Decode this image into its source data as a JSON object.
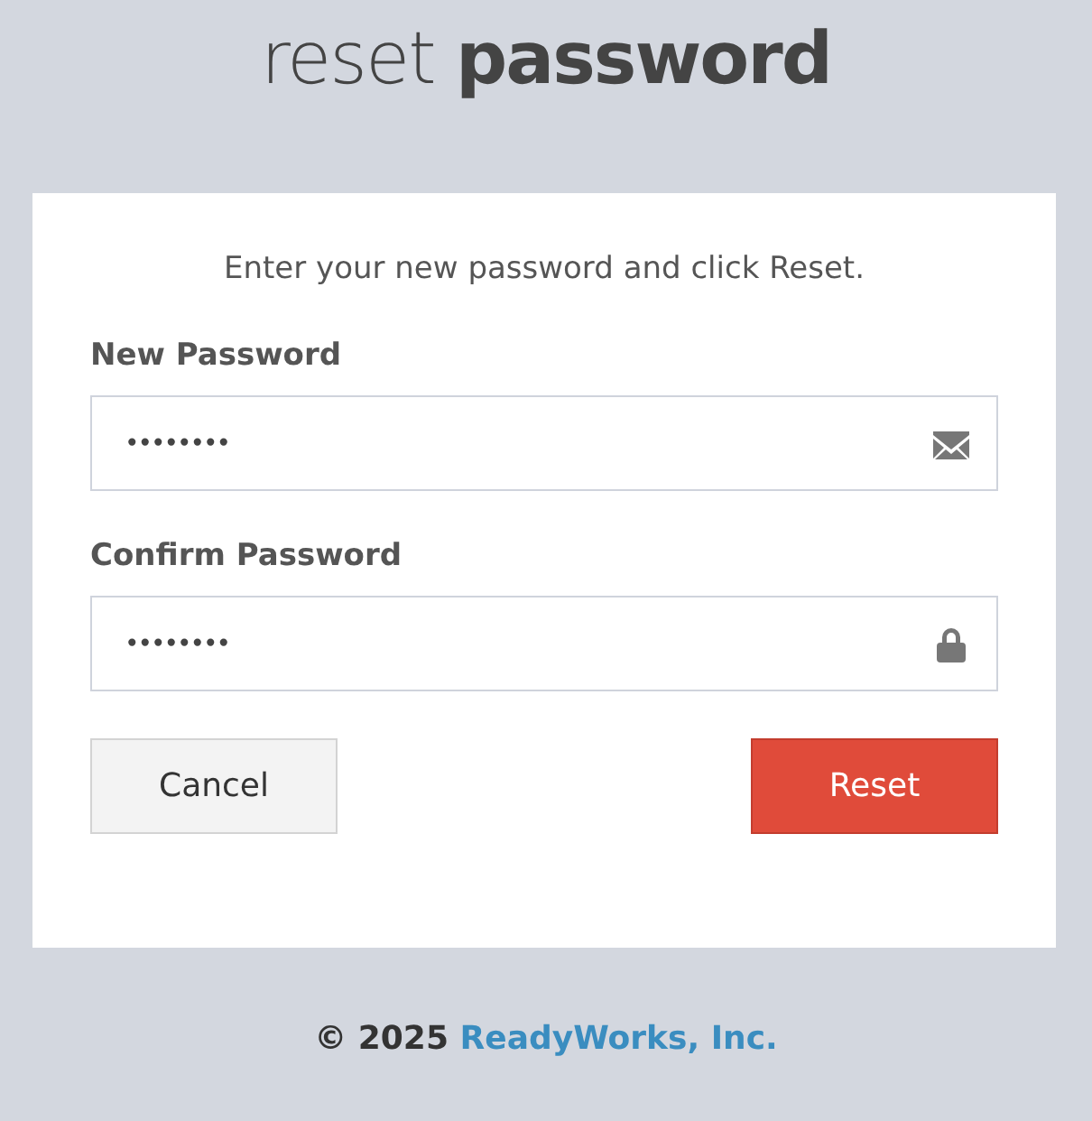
{
  "title": "reset **password**",
  "instructions": "Enter your new password and click Reset.",
  "fields": [
    {
      "label": "New Password",
      "value": "••••••••",
      "kind": "mail"
    },
    {
      "label": "Confirm Password",
      "value": "••••••••",
      "kind": "lock"
    }
  ],
  "buttons": [
    {
      "label": "Cancel",
      "kind": "secondary"
    },
    {
      "label": "Reset",
      "kind": "primary"
    }
  ],
  "footer": {
    "copyright": "© 2025",
    "link": "ReadyWorks, Inc."
  }
}
